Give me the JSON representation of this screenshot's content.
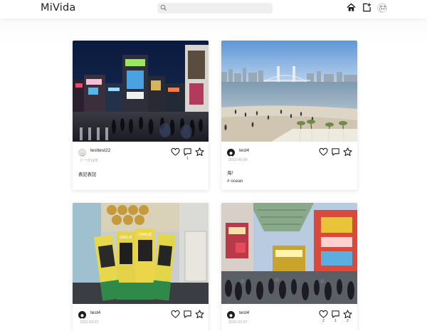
{
  "app": {
    "title": "MiVida"
  },
  "search": {
    "placeholder": "",
    "value": ""
  },
  "header_icons": [
    "home-icon",
    "add-post-icon",
    "profile-avatar"
  ],
  "posts": [
    {
      "username": "testtest22",
      "date": "ドーがは年",
      "caption": "表記表記",
      "tag": "",
      "avatar": "avatar-light",
      "likes": "",
      "comments": "1",
      "bookmarks": "",
      "photo": "Shibuya crossing at night"
    },
    {
      "username": "test4",
      "date": "2022-06-09",
      "caption": "海！",
      "tag": "# ocean",
      "avatar": "avatar-dark",
      "likes": "",
      "comments": "",
      "bookmarks": "",
      "photo": "Odaiba beach with Rainbow Bridge"
    },
    {
      "username": "test4",
      "date": "2022-03-07",
      "caption": "",
      "tag": "",
      "avatar": "avatar-dark",
      "likes": "",
      "comments": "",
      "bookmarks": "",
      "photo": "Darlie toothpaste boxes in a store"
    },
    {
      "username": "test4",
      "date": "2022-03-07",
      "caption": "",
      "tag": "",
      "avatar": "avatar-dark",
      "likes": "2",
      "comments": "1",
      "bookmarks": "2",
      "photo": "Akihabara street crowd"
    }
  ],
  "colors": {
    "accent": "#222222",
    "muted": "#aaaaaa",
    "search_bg": "#efefef"
  }
}
